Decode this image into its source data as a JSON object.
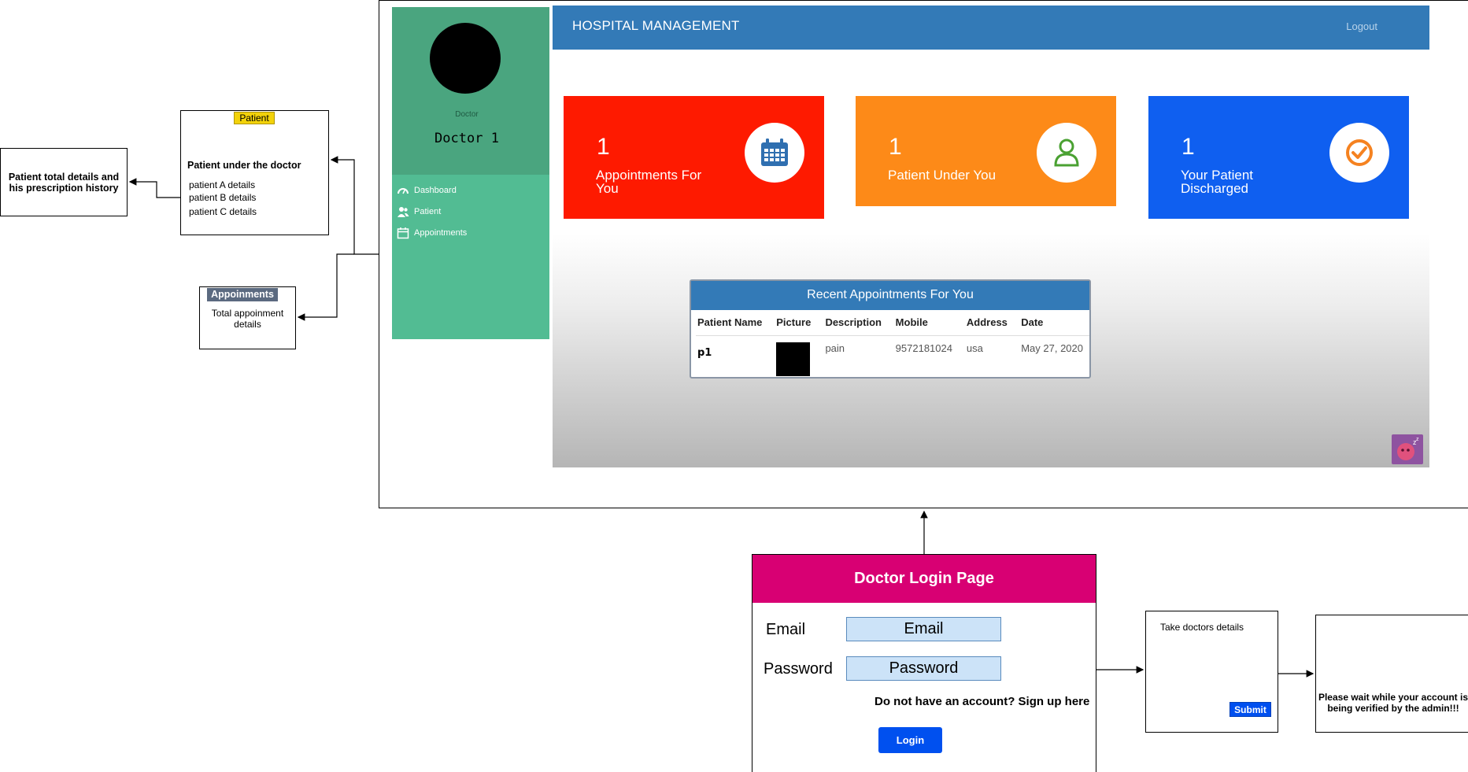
{
  "left_boxes": {
    "prescription": "Patient total details and his prescription history",
    "patient_tag": "Patient",
    "patient_heading": "Patient under the doctor",
    "patient_lines": [
      "patient A details",
      "patient B details",
      "patient C details"
    ],
    "appoint_tag": "Appoinments",
    "appoint_text": "Total appoinment details"
  },
  "dashboard": {
    "sidebar": {
      "role": "Doctor",
      "doctor_name": "Doctor 1",
      "nav": [
        {
          "label": "Dashboard",
          "icon": "gauge-icon"
        },
        {
          "label": "Patient",
          "icon": "users-icon"
        },
        {
          "label": "Appointments",
          "icon": "calendar-icon"
        }
      ]
    },
    "header": {
      "title": "HOSPITAL MANAGEMENT",
      "logout": "Logout"
    },
    "cards": [
      {
        "count": "1",
        "label": "Appointments For You",
        "icon": "calendar-icon",
        "color": "#fe1a00"
      },
      {
        "count": "1",
        "label": "Patient Under You",
        "icon": "user-icon",
        "color": "#fd8a18"
      },
      {
        "count": "1",
        "label": "Your Patient Discharged",
        "icon": "check-circle-icon",
        "color": "#0f5ff0"
      }
    ],
    "table": {
      "title": "Recent Appointments For You",
      "columns": [
        "Patient Name",
        "Picture",
        "Description",
        "Mobile",
        "Address",
        "Date"
      ],
      "rows": [
        {
          "name": "p1",
          "description": "pain",
          "mobile": "9572181024",
          "address": "usa",
          "date": "May 27, 2020"
        }
      ]
    }
  },
  "login": {
    "title": "Doctor Login Page",
    "email_label": "Email",
    "email_placeholder": "Email",
    "password_label": "Password",
    "password_placeholder": "Password",
    "signup_text": "Do not have an account? Sign up here",
    "login_button": "Login"
  },
  "details_box": {
    "text": "Take doctors details",
    "submit": "Submit"
  },
  "wait_box": {
    "text": "Please wait while your account is being verified by the admin!!!"
  },
  "colors": {
    "login_header": "#d80073",
    "primary_blue": "#337ab7",
    "button_blue": "#0050ef",
    "tag_yellow": "#f2d20a"
  }
}
